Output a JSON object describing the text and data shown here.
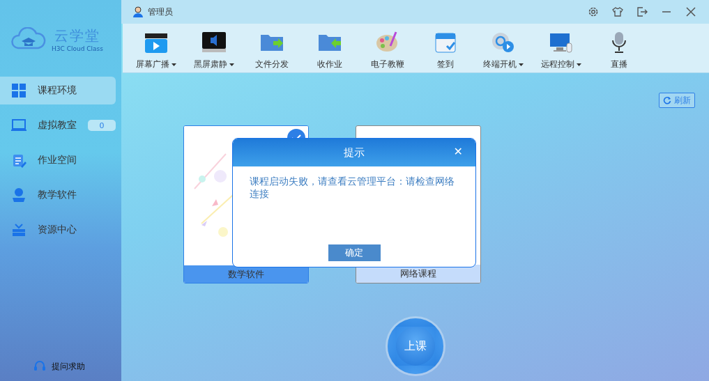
{
  "app": {
    "name": "云学堂",
    "subtitle": "H3C Cloud Class"
  },
  "user": {
    "name": "管理员"
  },
  "toolbar": [
    {
      "label": "屏幕广播",
      "dropdown": true
    },
    {
      "label": "黑屏肃静",
      "dropdown": true
    },
    {
      "label": "文件分发",
      "dropdown": false
    },
    {
      "label": "收作业",
      "dropdown": false
    },
    {
      "label": "电子教鞭",
      "dropdown": false
    },
    {
      "label": "签到",
      "dropdown": false
    },
    {
      "label": "终端开机",
      "dropdown": true
    },
    {
      "label": "远程控制",
      "dropdown": true
    },
    {
      "label": "直播",
      "dropdown": false
    }
  ],
  "sidebar": {
    "items": [
      {
        "label": "课程环境",
        "selected": true
      },
      {
        "label": "虚拟教室",
        "selected": false,
        "badge": "0"
      },
      {
        "label": "作业空间",
        "selected": false
      },
      {
        "label": "教学软件",
        "selected": false
      },
      {
        "label": "资源中心",
        "selected": false
      }
    ],
    "help": "提问求助"
  },
  "refresh": "刷新",
  "courses": [
    {
      "title": "数学软件",
      "selected": true
    },
    {
      "title": "网络课程",
      "selected": false
    }
  ],
  "start_button": "上课",
  "dialog": {
    "title": "提示",
    "close": "✕",
    "message": "课程启动失败，请查看云管理平台：请检查网络连接",
    "ok": "确定"
  }
}
